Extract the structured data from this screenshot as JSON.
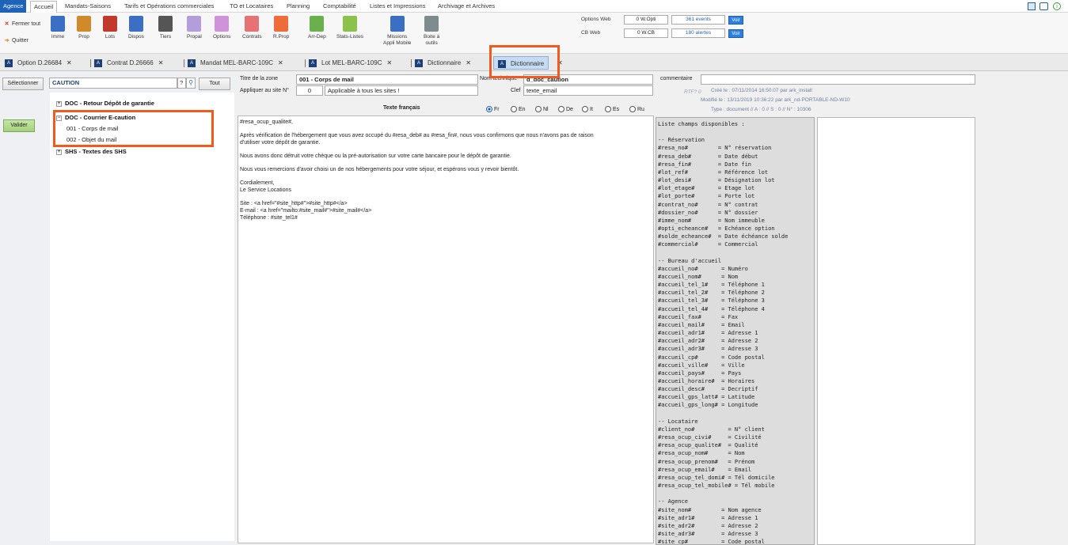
{
  "menu": [
    "Agence",
    "Accueil",
    "Mandats-Saisons",
    "Tarifs et Opérations commerciales",
    "TO et Locataires",
    "Planning",
    "Comptabilité",
    "Listes et Impressions",
    "Archivage et Archives"
  ],
  "ribbon": {
    "side_buttons": [
      {
        "icon": "close-x-icon",
        "label": "Fermer tout"
      },
      {
        "icon": "exit-arrow-icon",
        "label": "Quitter"
      }
    ],
    "buttons": [
      {
        "label": "Imme",
        "icon": "building-icon",
        "color": "#3a6fc4"
      },
      {
        "label": "Prop",
        "icon": "owners-icon",
        "color": "#d08a2a"
      },
      {
        "label": "Lots",
        "icon": "lots-icon",
        "color": "#c0392b"
      },
      {
        "label": "Dispos",
        "icon": "calendar-icon",
        "color": "#3a6fc4"
      },
      {
        "label": "Tiers",
        "icon": "binoculars-icon",
        "color": "#555555"
      },
      {
        "label": "Propal",
        "icon": "document-icon",
        "color": "#b39ddb"
      },
      {
        "label": "Options",
        "icon": "document-icon",
        "color": "#ce93d8"
      },
      {
        "label": "Contrats",
        "icon": "document-icon",
        "color": "#e57373"
      },
      {
        "label": "R.Prop",
        "icon": "document-icon",
        "color": "#ef6c3a"
      },
      {
        "label": "Arr-Dep",
        "icon": "flow-icon",
        "color": "#6ab04c"
      },
      {
        "label": "Stats-Listes",
        "icon": "list-icon",
        "color": "#8bc34a"
      },
      {
        "label": "Missions\nAppli Mobile",
        "icon": "mobile-icon",
        "color": "#3a6fc4"
      },
      {
        "label": "Boite à\noutils",
        "icon": "tools-icon",
        "color": "#7f8c8d"
      }
    ],
    "web": {
      "options_label": "Options Web",
      "options_value": "0 W.Opti",
      "options_events": "361 events",
      "cb_label": "CB Web",
      "cb_value": "0 W.CB",
      "cb_alerts": "180 alertes",
      "voir_label": "Voir"
    }
  },
  "tabs": [
    {
      "label": "Option D.26684",
      "active": false
    },
    {
      "label": "Contrat D.26666",
      "active": false
    },
    {
      "label": "Mandat MEL-BARC-109C",
      "active": false
    },
    {
      "label": "Lot MEL-BARC-109C",
      "active": false
    },
    {
      "label": "Dictionnaire",
      "active": false
    },
    {
      "label": "Dictionnaire",
      "active": true
    }
  ],
  "left": {
    "selectionner": "Sélectionner",
    "search_value": "CAUTION",
    "help_label": "?",
    "tout": "Tout",
    "valider": "Valider",
    "tree": [
      {
        "label": "DOC - Retour Dépôt de garantie",
        "expanded": false
      },
      {
        "label": "DOC - Courrier E-caution",
        "expanded": true,
        "children": [
          "001 - Corps de mail",
          "002 - Objet du mail"
        ]
      },
      {
        "label": "SHS - Textes des SHS",
        "expanded": false
      }
    ]
  },
  "form": {
    "zone_label": "Titre de la zone",
    "zone_value": "001 - Corps de mail",
    "site_label": "Appliquer au site N°",
    "site_value": "0",
    "site_desc": "Applicable à tous les sites !",
    "tech_label": "Nom technique",
    "tech_value": "d_doc_caution",
    "clef_label": "Clef",
    "clef_value": "texte_email",
    "comment_label": "commentaire",
    "comment_value": "",
    "rtf": "RTF? 0",
    "created": "Créé le : 07/11/2014 16:50:07 par ark_install",
    "modified": "Modifié le : 13/11/2019 10:36:22 par ark_nd-PORTABLE-ND-W10",
    "type": "Type : document // A : 0  // S : 0  // N° : 10306",
    "texte_header": "Texte français",
    "languages": [
      "Fr",
      "En",
      "Nl",
      "De",
      "It",
      "Es",
      "Ru"
    ],
    "selected_language": "Fr"
  },
  "editor": {
    "paragraphs": [
      "#resa_ocup_qualite#,",
      "Après vérification de l'hébergement que vous avez occupé du #resa_deb# au #resa_fin#, nous vous confirmons que nous n'avons pas de raison\nd'utiliser votre dépôt de garantie.",
      "Nous avons donc détruit votre chèque ou la pré-autorisation sur votre carte bancaire pour le dépôt de garantie.",
      "Nous vous remercions d'avoir choisi un de nos hébergements pour votre séjour, et espérons vous y revoir bientôt.",
      "Cordialement,\nLe Service Locations",
      "Site : <a href=\"#site_http#\">#site_http#</a>\nE-mail : <a href=\"mailto:#site_mail#\">#site_mail#</a>\nTéléphone : #site_tel1#"
    ]
  },
  "field_list": "Liste champs disponibles :\n\n-- Réservation\n#resa_no#         = N° réservation\n#resa_deb#        = Date début\n#resa_fin#        = Date fin\n#lot_ref#         = Référence lot\n#lot_desi#        = Désignation lot\n#lot_etage#       = Etage lot\n#lot_porte#       = Porte lot\n#contrat_no#      = N° contrat\n#dossier_no#      = N° dossier\n#imme_nom#        = Nom immeuble\n#opti_echeance#   = Echéance option\n#solde_echeance#  = Date échéance solde\n#commercial#      = Commercial\n\n-- Bureau d'accueil\n#accueil_no#       = Numéro\n#accueil_nom#      = Nom\n#accueil_tel_1#    = Téléphone 1\n#accueil_tel_2#    = Téléphone 2\n#accueil_tel_3#    = Téléphone 3\n#accueil_tel_4#    = Téléphone 4\n#accueil_fax#      = Fax\n#accueil_mail#     = Email\n#accueil_adr1#     = Adresse 1\n#accueil_adr2#     = Adresse 2\n#accueil_adr3#     = Adresse 3\n#accueil_cp#       = Code postal\n#accueil_ville#    = Ville\n#accueil_pays#     = Pays\n#accueil_horaire#  = Horaires\n#accueil_desc#     = Decriptif\n#accueil_gps_latt# = Latitude\n#accueil_gps_long# = Longitude\n\n-- Locataire\n#client_no#          = N° client\n#resa_ocup_civi#     = Civilité\n#resa_ocup_qualite#  = Qualité\n#resa_ocup_nom#      = Nom\n#resa_ocup_prenom#   = Prénom\n#resa_ocup_email#    = Email\n#resa_ocup_tel_domi# = Tél domicile\n#resa_ocup_tel_mobile# = Tél mobile\n\n-- Agence\n#site_nom#         = Nom agence\n#site_adr1#        = Adresse 1\n#site_adr2#        = Adresse 2\n#site_adr3#        = Adresse 3\n#site_cp#          = Code postal",
  "window_controls": [
    "app-icon",
    "window-icon",
    "info-icon"
  ],
  "colors": {
    "highlight": "#f05a1e",
    "accent": "#1e63b8",
    "active_tab": "#c6dcf2"
  }
}
